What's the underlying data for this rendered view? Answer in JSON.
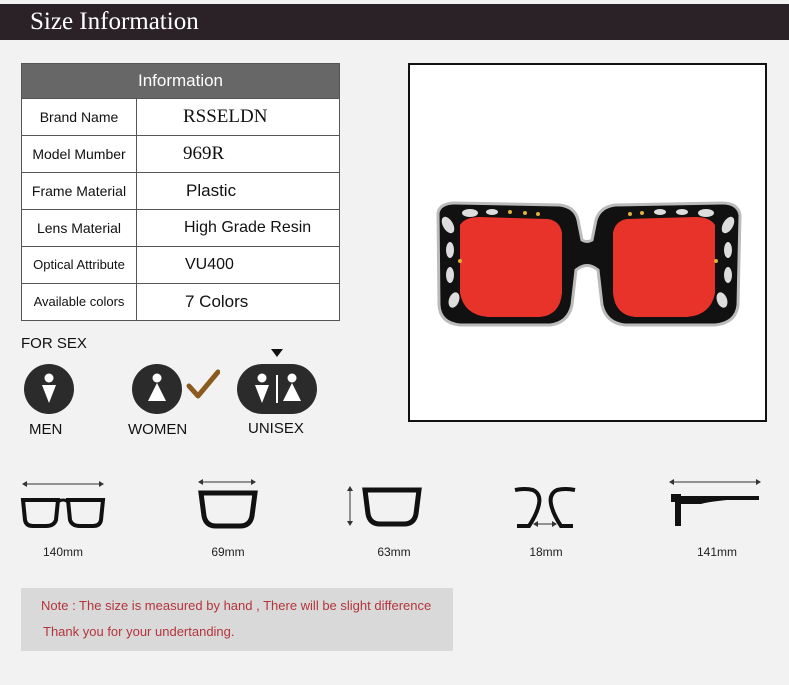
{
  "header": {
    "title": "Size Information"
  },
  "info_table": {
    "heading": "Information",
    "rows": [
      {
        "key": "Brand Name",
        "value": "RSSELDN"
      },
      {
        "key": "Model Mumber",
        "value": "969R"
      },
      {
        "key": "Frame Material",
        "value": "Plastic"
      },
      {
        "key": "Lens Material",
        "value": "High Grade Resin"
      },
      {
        "key": "Optical Attribute",
        "value": "VU400"
      },
      {
        "key": "Available colors",
        "value": "7 Colors"
      }
    ]
  },
  "sex": {
    "title": "FOR SEX",
    "options": [
      {
        "label": "MEN",
        "icon": "man-icon"
      },
      {
        "label": "WOMEN",
        "icon": "woman-icon",
        "checked": true
      },
      {
        "label": "UNISEX",
        "icon": "unisex-icon"
      }
    ],
    "check_color": "#8a5a1e"
  },
  "dimensions": [
    {
      "label": "140mm",
      "icon": "frame-width-icon"
    },
    {
      "label": "69mm",
      "icon": "lens-width-icon"
    },
    {
      "label": "63mm",
      "icon": "lens-height-icon"
    },
    {
      "label": "18mm",
      "icon": "bridge-width-icon"
    },
    {
      "label": "141mm",
      "icon": "temple-length-icon"
    }
  ],
  "note": {
    "line1": "Note : The size is measured by hand , There will be slight difference",
    "line2": "Thank you for your undertanding."
  },
  "colors": {
    "header_bg": "#2b2227",
    "note_text": "#b4343b",
    "lens": "#e8332a"
  }
}
